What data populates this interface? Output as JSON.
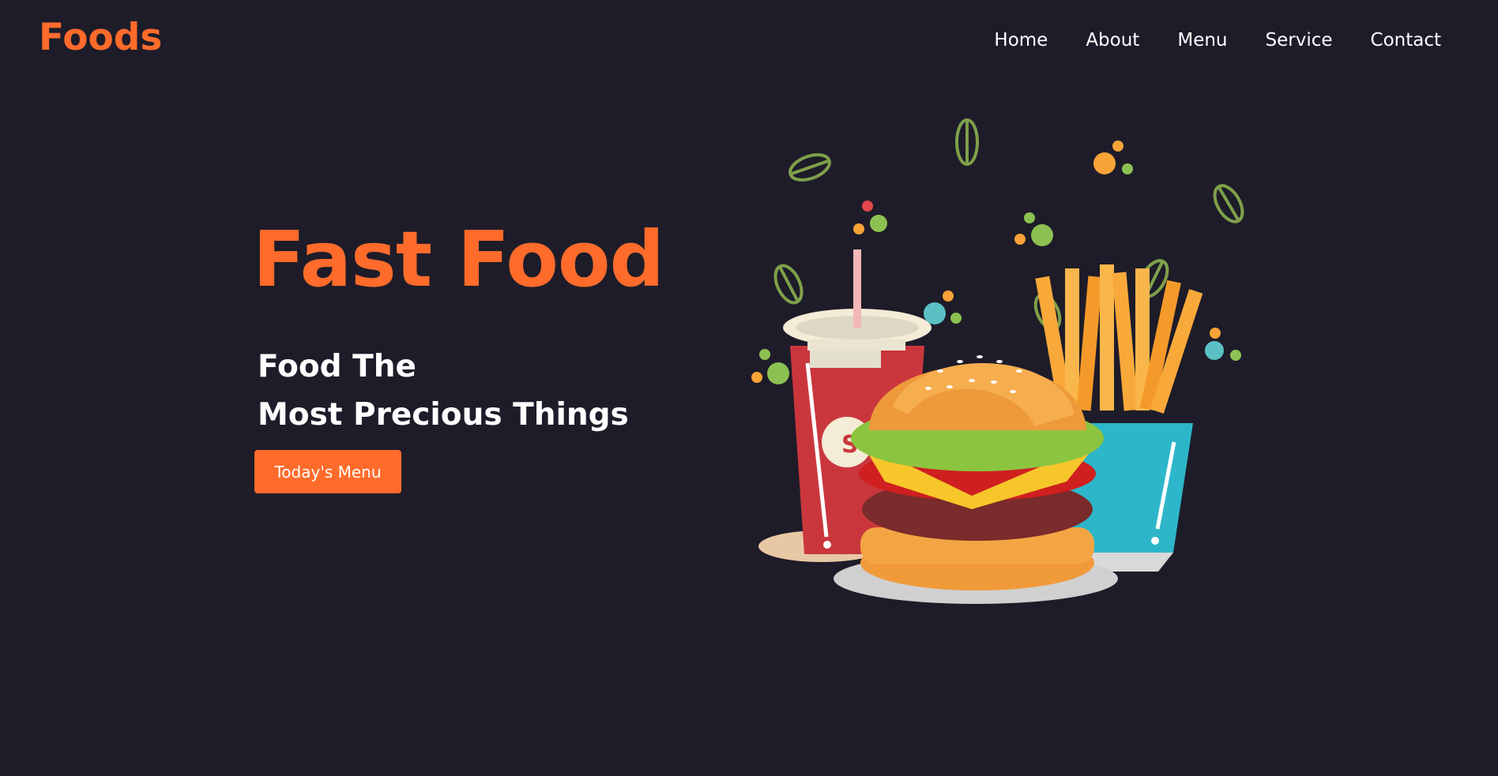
{
  "header": {
    "logo": "Foods",
    "nav": [
      "Home",
      "About",
      "Menu",
      "Service",
      "Contact"
    ]
  },
  "hero": {
    "title": "Fast Food",
    "subtitle_line1": "Food The",
    "subtitle_line2": "Most Precious Things",
    "button_label": "Today's Menu"
  },
  "illustration": {
    "icon": "fast-food-illustration",
    "cup_label": "S"
  },
  "colors": {
    "background": "#1e1c29",
    "accent": "#ff6b2b",
    "text": "#ffffff"
  }
}
